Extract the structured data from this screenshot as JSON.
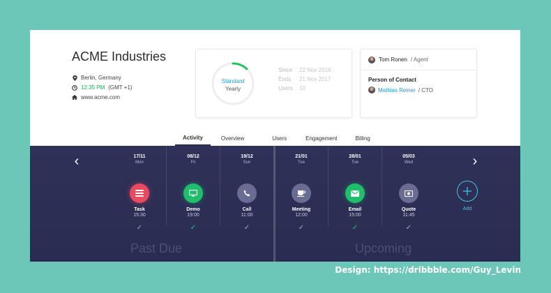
{
  "company": {
    "name": "ACME Industries",
    "location": "Berlin, Germany",
    "time": "12:35 PM",
    "timezone": "(GMT +1)",
    "website": "www.acme.com"
  },
  "plan": {
    "name": "Standard",
    "billing": "Yearly",
    "progress": 0.12,
    "since_label": "Since",
    "since_value": "22 Nov 2016",
    "ends_label": "Ends",
    "ends_value": "21 Nov 2017",
    "users_label": "Users",
    "users_value": "10"
  },
  "contact": {
    "agent_name": "Tom Ronen",
    "agent_role": "/ Agent",
    "poc_title": "Person of Contact",
    "poc_name": "Mathias Reiner",
    "poc_role": "/ CTO"
  },
  "tabs": [
    {
      "label": "Activity",
      "active": true
    },
    {
      "label": "Overview"
    },
    {
      "label": "Users"
    },
    {
      "label": "Engagement"
    },
    {
      "label": "Billing"
    }
  ],
  "timeline": {
    "events": [
      {
        "date": "17/11",
        "day": "Mon",
        "label": "Task",
        "time": "15:30",
        "color": "#e84a5f",
        "icon": "task-icon",
        "done": false
      },
      {
        "date": "08/12",
        "day": "Fri",
        "label": "Demo",
        "time": "19:00",
        "color": "#1fbf6b",
        "icon": "monitor-icon",
        "done": true
      },
      {
        "date": "19/12",
        "day": "Sun",
        "label": "Call",
        "time": "11:00",
        "color": "#6a6d93",
        "icon": "phone-icon",
        "done": false
      },
      {
        "date": "21/01",
        "day": "Tue",
        "label": "Meeting",
        "time": "12:00",
        "color": "#6a6d93",
        "icon": "coffee-icon",
        "done": false
      },
      {
        "date": "28/01",
        "day": "Tue",
        "label": "Email",
        "time": "15:00",
        "color": "#1fbf6b",
        "icon": "envelope-icon",
        "done": true
      },
      {
        "date": "05/03",
        "day": "Wed",
        "label": "Quote",
        "time": "11:45",
        "color": "#6a6d93",
        "icon": "money-icon",
        "done": false
      }
    ],
    "add_label": "Add",
    "past_label": "Past Due",
    "upcoming_label": "Upcoming"
  },
  "credit": "Design: https://dribbble.com/Guy_Levin"
}
